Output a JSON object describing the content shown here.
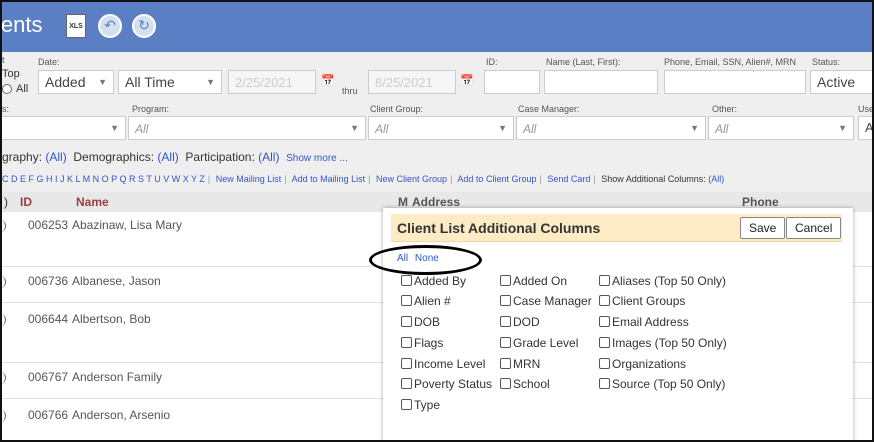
{
  "header": {
    "title": "ients",
    "xls_label": "XLS"
  },
  "filters": {
    "labels": {
      "top_partial": "t",
      "date": "Date:",
      "id": "ID:",
      "name": "Name (Last, First):",
      "phone": "Phone, Email, SSN, Alien#, MRN",
      "status": "Status:",
      "program": "Program:",
      "client_group": "Client Group:",
      "case_manager": "Case Manager:",
      "other": "Other:",
      "user_partial": "Use",
      "top": "Top",
      "all": "All",
      "thru": "thru",
      "s_partial": "s:"
    },
    "date_type": "Added",
    "date_range": "All Time",
    "date_from": "2/25/2021",
    "date_to": "8/25/2021",
    "status": "Active",
    "all_value": "All",
    "user_value": "Al"
  },
  "summary": {
    "prefix": "graphy:",
    "geo_value": "(All)",
    "demographics": "Demographics:",
    "demo_value": "(All)",
    "participation": "Participation:",
    "part_value": "(All)",
    "show_more": "Show more ..."
  },
  "toolbar": {
    "alphabet": "C D E F G H I J K L M N O P Q R S T U V W X Y Z",
    "new_mailing_list": "New Mailing List",
    "add_to_mailing_list": "Add to Mailing List",
    "new_client_group": "New Client Group",
    "add_to_client_group": "Add to Client Group",
    "send_card": "Send Card",
    "show_additional": "Show Additional Columns:",
    "show_additional_value": "(All)"
  },
  "table": {
    "columns": {
      "id": "ID",
      "name": "Name",
      "m": "M",
      "address": "Address",
      "phone": "Phone"
    },
    "rows": [
      {
        "id": "006253",
        "name": "Abazinaw, Lisa Mary"
      },
      {
        "id": "006736",
        "name": "Albanese, Jason"
      },
      {
        "id": "006644",
        "name": "Albertson, Bob"
      },
      {
        "id": "006767",
        "name": "Anderson Family"
      },
      {
        "id": "006766",
        "name": "Anderson, Arsenio"
      }
    ]
  },
  "dialog": {
    "title": "Client List Additional Columns",
    "save": "Save",
    "cancel": "Cancel",
    "link_all": "All",
    "link_none": "None",
    "col1": [
      "Added By",
      "Alien #",
      "DOB",
      "Flags",
      "Income Level",
      "Poverty Status",
      "Type"
    ],
    "col2": [
      "Added On",
      "Case Manager",
      "DOD",
      "Grade Level",
      "MRN",
      "School"
    ],
    "col3": [
      "Aliases (Top 50 Only)",
      "Client Groups",
      "Email Address",
      "Images (Top 50 Only)",
      "Organizations",
      "Source (Top 50 Only)"
    ]
  }
}
